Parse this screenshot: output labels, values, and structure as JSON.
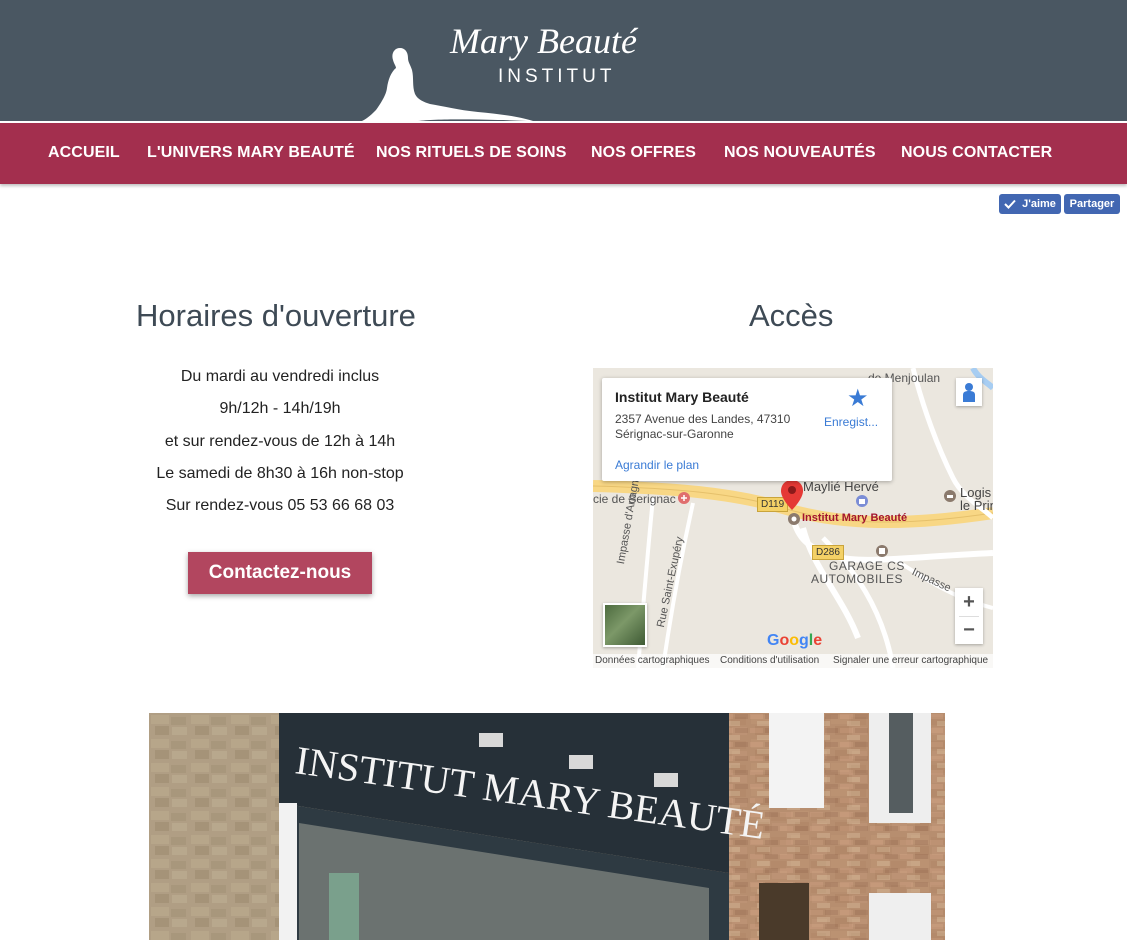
{
  "header": {
    "logo_title": "Mary Beauté",
    "logo_subtitle": "INSTITUT"
  },
  "nav": {
    "items": [
      {
        "label": "ACCUEIL"
      },
      {
        "label": "L'UNIVERS MARY BEAUTÉ"
      },
      {
        "label": "NOS RITUELS DE SOINS"
      },
      {
        "label": "NOS OFFRES"
      },
      {
        "label": "NOS NOUVEAUTÉS"
      },
      {
        "label": "NOUS CONTACTER"
      }
    ]
  },
  "social": {
    "like_label": "J'aime",
    "share_label": "Partager"
  },
  "hours": {
    "title": "Horaires d'ouverture",
    "lines": [
      "Du mardi au vendredi inclus",
      "9h/12h - 14h/19h",
      "et sur rendez-vous de 12h à 14h",
      "Le samedi de 8h30 à 16h non-stop",
      "Sur rendez-vous 05 53 66 68 03"
    ],
    "contact_button": "Contactez-nous"
  },
  "access": {
    "title": "Accès",
    "map": {
      "place_name": "Institut Mary Beauté",
      "address_line1": "2357 Avenue des Landes, 47310",
      "address_line2": "Sérignac-sur-Garonne",
      "enlarge_link": "Agrandir le plan",
      "save_label": "Enregist...",
      "labels": {
        "menjoulan": "de Menjoulan",
        "serignac": "cie de Serignac",
        "maylie": "Maylié Hervé",
        "logis": "Logis",
        "le_prin": "le Prin",
        "institut": "Institut Mary Beauté",
        "garage1": "GARAGE CS",
        "garage2": "AUTOMOBILES",
        "impasse_artagnan": "Impasse d'Artagnan",
        "rue_st_exupery": "Rue Saint-Exupéry",
        "impasse_right": "Impasse",
        "road_d119": "D119",
        "road_d286": "D286"
      },
      "zoom_in": "+",
      "zoom_out": "−",
      "google_logo": [
        "G",
        "o",
        "o",
        "g",
        "l",
        "e"
      ],
      "footer": {
        "data": "Données cartographiques",
        "terms": "Conditions d'utilisation",
        "report": "Signaler une erreur cartographique"
      }
    }
  },
  "storefront": {
    "sign_text": "INSTITUT MARY BEAUTÉ"
  },
  "colors": {
    "header_bg": "#4a5762",
    "nav_bg": "#a32f4e",
    "button_bg": "#b2465f",
    "heading": "#3e4a55",
    "facebook": "#4267b2"
  }
}
